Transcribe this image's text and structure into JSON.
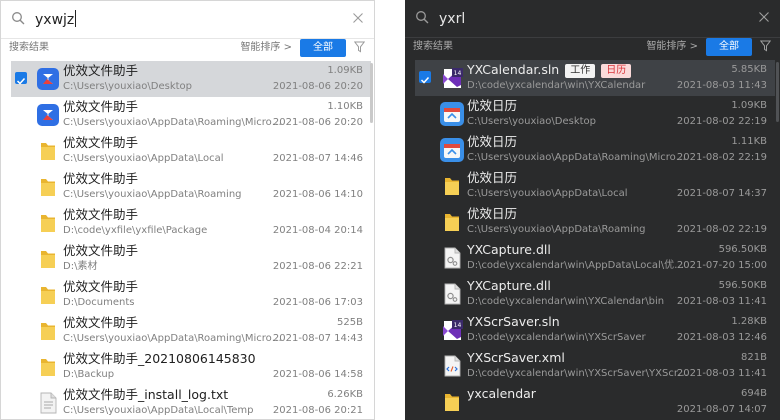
{
  "colors": {
    "accent": "#1a7ae6",
    "light_bg": "#ffffff",
    "dark_bg": "#2a2b2c",
    "light_selected": "#d5d7da",
    "dark_selected": "#3f4246",
    "tag_cal_text": "#d9343a"
  },
  "light": {
    "query": "yxwjz",
    "results_label": "搜索结果",
    "sort_label": "智能排序 >",
    "filter_all": "全部",
    "items": [
      {
        "name": "优效文件助手",
        "path": "C:\\Users\\youxiao\\Desktop",
        "size": "1.09KB",
        "date": "2021-08-06 20:20",
        "icon": "app-icon",
        "selected": true
      },
      {
        "name": "优效文件助手",
        "path": "C:\\Users\\youxiao\\AppData\\Roaming\\Microsoft\\...",
        "size": "1.10KB",
        "date": "2021-08-06 20:20",
        "icon": "app-icon"
      },
      {
        "name": "优效文件助手",
        "path": "C:\\Users\\youxiao\\AppData\\Local",
        "size": "",
        "date": "2021-08-07 14:46",
        "icon": "folder-icon"
      },
      {
        "name": "优效文件助手",
        "path": "C:\\Users\\youxiao\\AppData\\Roaming",
        "size": "",
        "date": "2021-08-06 14:10",
        "icon": "folder-icon"
      },
      {
        "name": "优效文件助手",
        "path": "D:\\code\\yxfile\\yxfile\\Package",
        "size": "",
        "date": "2021-08-04 20:14",
        "icon": "folder-icon"
      },
      {
        "name": "优效文件助手",
        "path": "D:\\素材",
        "size": "",
        "date": "2021-08-06 22:21",
        "icon": "folder-icon"
      },
      {
        "name": "优效文件助手",
        "path": "D:\\Documents",
        "size": "",
        "date": "2021-08-06 17:03",
        "icon": "folder-icon"
      },
      {
        "name": "优效文件助手",
        "path": "C:\\Users\\youxiao\\AppData\\Roaming\\Microsoft\\...",
        "size": "525B",
        "date": "2021-08-07 14:43",
        "icon": "folder-icon"
      },
      {
        "name": "优效文件助手_20210806145830",
        "path": "D:\\Backup",
        "size": "",
        "date": "2021-08-06 14:58",
        "icon": "folder-icon"
      },
      {
        "name": "优效文件助手_install_log.txt",
        "path": "C:\\Users\\youxiao\\AppData\\Local\\Temp",
        "size": "6.26KB",
        "date": "2021-08-06 20:21",
        "icon": "text-file-icon"
      }
    ]
  },
  "dark": {
    "query": "yxrl",
    "results_label": "搜索结果",
    "sort_label": "智能排序 >",
    "filter_all": "全部",
    "tags": {
      "work": "工作",
      "calendar": "日历"
    },
    "items": [
      {
        "name": "YXCalendar.sln",
        "path": "D:\\code\\yxcalendar\\win\\YXCalendar",
        "size": "5.85KB",
        "date": "2021-08-03 11:43",
        "icon": "vs-icon",
        "selected": true,
        "tagged": true
      },
      {
        "name": "优效日历",
        "path": "C:\\Users\\youxiao\\Desktop",
        "size": "1.09KB",
        "date": "2021-08-02 22:19",
        "icon": "calendar-icon"
      },
      {
        "name": "优效日历",
        "path": "C:\\Users\\youxiao\\AppData\\Roaming\\Microsoft\\...",
        "size": "1.11KB",
        "date": "2021-08-02 22:19",
        "icon": "calendar-icon"
      },
      {
        "name": "优效日历",
        "path": "C:\\Users\\youxiao\\AppData\\Local",
        "size": "",
        "date": "2021-08-07 14:37",
        "icon": "folder-icon"
      },
      {
        "name": "优效日历",
        "path": "C:\\Users\\youxiao\\AppData\\Roaming",
        "size": "",
        "date": "2021-08-02 22:19",
        "icon": "folder-icon"
      },
      {
        "name": "YXCapture.dll",
        "path": "D:\\code\\yxcalendar\\win\\AppData\\Local\\优效日历",
        "size": "596.50KB",
        "date": "2021-07-20 15:00",
        "icon": "dll-icon"
      },
      {
        "name": "YXCapture.dll",
        "path": "D:\\code\\yxcalendar\\win\\YXCalendar\\bin",
        "size": "596.50KB",
        "date": "2021-08-03 11:41",
        "icon": "dll-icon"
      },
      {
        "name": "YXScrSaver.sln",
        "path": "D:\\code\\yxcalendar\\win\\YXScrSaver",
        "size": "1.28KB",
        "date": "2021-08-03 12:46",
        "icon": "vs-icon"
      },
      {
        "name": "YXScrSaver.xml",
        "path": "D:\\code\\yxcalendar\\win\\YXScrSaver\\YXScrSaver",
        "size": "821B",
        "date": "2021-08-03 11:41",
        "icon": "xml-icon"
      },
      {
        "name": "yxcalendar",
        "path": "",
        "size": "694B",
        "date": "2021-08-07 14:07",
        "icon": "folder-icon"
      }
    ]
  }
}
